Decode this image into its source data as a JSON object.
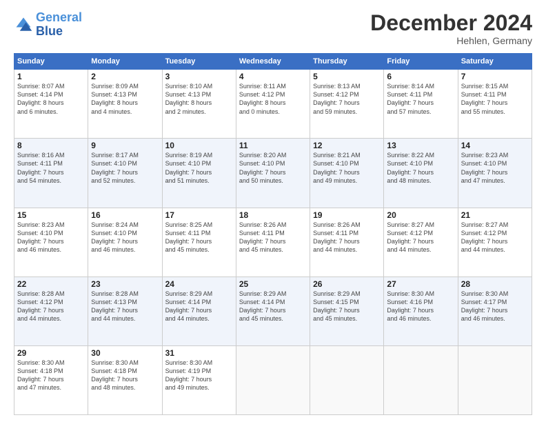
{
  "logo": {
    "line1": "General",
    "line2": "Blue"
  },
  "title": "December 2024",
  "location": "Hehlen, Germany",
  "days_header": [
    "Sunday",
    "Monday",
    "Tuesday",
    "Wednesday",
    "Thursday",
    "Friday",
    "Saturday"
  ],
  "weeks": [
    [
      {
        "day": "1",
        "info": "Sunrise: 8:07 AM\nSunset: 4:14 PM\nDaylight: 8 hours\nand 6 minutes."
      },
      {
        "day": "2",
        "info": "Sunrise: 8:09 AM\nSunset: 4:13 PM\nDaylight: 8 hours\nand 4 minutes."
      },
      {
        "day": "3",
        "info": "Sunrise: 8:10 AM\nSunset: 4:13 PM\nDaylight: 8 hours\nand 2 minutes."
      },
      {
        "day": "4",
        "info": "Sunrise: 8:11 AM\nSunset: 4:12 PM\nDaylight: 8 hours\nand 0 minutes."
      },
      {
        "day": "5",
        "info": "Sunrise: 8:13 AM\nSunset: 4:12 PM\nDaylight: 7 hours\nand 59 minutes."
      },
      {
        "day": "6",
        "info": "Sunrise: 8:14 AM\nSunset: 4:11 PM\nDaylight: 7 hours\nand 57 minutes."
      },
      {
        "day": "7",
        "info": "Sunrise: 8:15 AM\nSunset: 4:11 PM\nDaylight: 7 hours\nand 55 minutes."
      }
    ],
    [
      {
        "day": "8",
        "info": "Sunrise: 8:16 AM\nSunset: 4:11 PM\nDaylight: 7 hours\nand 54 minutes."
      },
      {
        "day": "9",
        "info": "Sunrise: 8:17 AM\nSunset: 4:10 PM\nDaylight: 7 hours\nand 52 minutes."
      },
      {
        "day": "10",
        "info": "Sunrise: 8:19 AM\nSunset: 4:10 PM\nDaylight: 7 hours\nand 51 minutes."
      },
      {
        "day": "11",
        "info": "Sunrise: 8:20 AM\nSunset: 4:10 PM\nDaylight: 7 hours\nand 50 minutes."
      },
      {
        "day": "12",
        "info": "Sunrise: 8:21 AM\nSunset: 4:10 PM\nDaylight: 7 hours\nand 49 minutes."
      },
      {
        "day": "13",
        "info": "Sunrise: 8:22 AM\nSunset: 4:10 PM\nDaylight: 7 hours\nand 48 minutes."
      },
      {
        "day": "14",
        "info": "Sunrise: 8:23 AM\nSunset: 4:10 PM\nDaylight: 7 hours\nand 47 minutes."
      }
    ],
    [
      {
        "day": "15",
        "info": "Sunrise: 8:23 AM\nSunset: 4:10 PM\nDaylight: 7 hours\nand 46 minutes."
      },
      {
        "day": "16",
        "info": "Sunrise: 8:24 AM\nSunset: 4:10 PM\nDaylight: 7 hours\nand 46 minutes."
      },
      {
        "day": "17",
        "info": "Sunrise: 8:25 AM\nSunset: 4:11 PM\nDaylight: 7 hours\nand 45 minutes."
      },
      {
        "day": "18",
        "info": "Sunrise: 8:26 AM\nSunset: 4:11 PM\nDaylight: 7 hours\nand 45 minutes."
      },
      {
        "day": "19",
        "info": "Sunrise: 8:26 AM\nSunset: 4:11 PM\nDaylight: 7 hours\nand 44 minutes."
      },
      {
        "day": "20",
        "info": "Sunrise: 8:27 AM\nSunset: 4:12 PM\nDaylight: 7 hours\nand 44 minutes."
      },
      {
        "day": "21",
        "info": "Sunrise: 8:27 AM\nSunset: 4:12 PM\nDaylight: 7 hours\nand 44 minutes."
      }
    ],
    [
      {
        "day": "22",
        "info": "Sunrise: 8:28 AM\nSunset: 4:12 PM\nDaylight: 7 hours\nand 44 minutes."
      },
      {
        "day": "23",
        "info": "Sunrise: 8:28 AM\nSunset: 4:13 PM\nDaylight: 7 hours\nand 44 minutes."
      },
      {
        "day": "24",
        "info": "Sunrise: 8:29 AM\nSunset: 4:14 PM\nDaylight: 7 hours\nand 44 minutes."
      },
      {
        "day": "25",
        "info": "Sunrise: 8:29 AM\nSunset: 4:14 PM\nDaylight: 7 hours\nand 45 minutes."
      },
      {
        "day": "26",
        "info": "Sunrise: 8:29 AM\nSunset: 4:15 PM\nDaylight: 7 hours\nand 45 minutes."
      },
      {
        "day": "27",
        "info": "Sunrise: 8:30 AM\nSunset: 4:16 PM\nDaylight: 7 hours\nand 46 minutes."
      },
      {
        "day": "28",
        "info": "Sunrise: 8:30 AM\nSunset: 4:17 PM\nDaylight: 7 hours\nand 46 minutes."
      }
    ],
    [
      {
        "day": "29",
        "info": "Sunrise: 8:30 AM\nSunset: 4:18 PM\nDaylight: 7 hours\nand 47 minutes."
      },
      {
        "day": "30",
        "info": "Sunrise: 8:30 AM\nSunset: 4:18 PM\nDaylight: 7 hours\nand 48 minutes."
      },
      {
        "day": "31",
        "info": "Sunrise: 8:30 AM\nSunset: 4:19 PM\nDaylight: 7 hours\nand 49 minutes."
      },
      {
        "day": "",
        "info": ""
      },
      {
        "day": "",
        "info": ""
      },
      {
        "day": "",
        "info": ""
      },
      {
        "day": "",
        "info": ""
      }
    ]
  ]
}
